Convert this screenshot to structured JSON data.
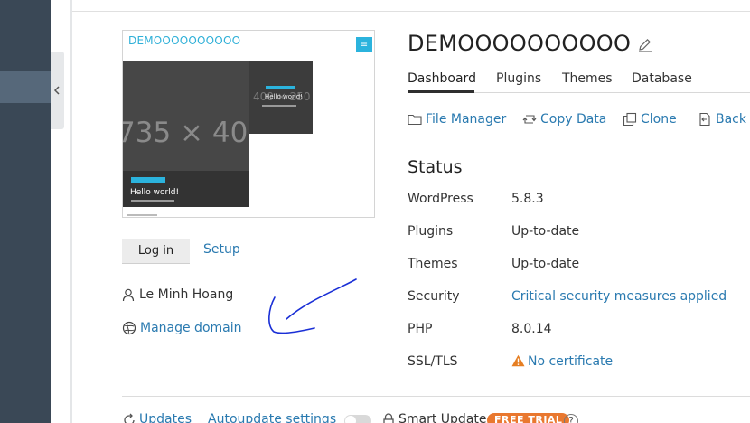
{
  "site": {
    "title": "DEMOOOOOOOOOO"
  },
  "preview": {
    "site_name": "DEMOOOOOOOOOO",
    "menu_glyph": "≡",
    "image_placeholder": "735 × 400",
    "small_placeholder": "400 × 250",
    "post_title_big": "Hello world!",
    "post_title_small": "Hello world!"
  },
  "buttons": {
    "login_label": "Log in",
    "setup_label": "Setup"
  },
  "owner": {
    "name": "Le Minh Hoang"
  },
  "domain": {
    "manage_label": "Manage domain"
  },
  "tabs": [
    {
      "label": "Dashboard",
      "active": true
    },
    {
      "label": "Plugins",
      "active": false
    },
    {
      "label": "Themes",
      "active": false
    },
    {
      "label": "Database",
      "active": false
    }
  ],
  "actions": [
    {
      "label": "File Manager",
      "icon": "folder-icon"
    },
    {
      "label": "Copy Data",
      "icon": "copy-data-icon"
    },
    {
      "label": "Clone",
      "icon": "clone-icon"
    },
    {
      "label": "Back U",
      "icon": "backup-icon"
    }
  ],
  "status": {
    "title": "Status",
    "rows": [
      {
        "key": "WordPress",
        "value": "5.8.3"
      },
      {
        "key": "Plugins",
        "value": "Up-to-date"
      },
      {
        "key": "Themes",
        "value": "Up-to-date"
      },
      {
        "key": "Security",
        "value": "Critical security measures applied"
      },
      {
        "key": "PHP",
        "value": "8.0.14"
      },
      {
        "key": "SSL/TLS",
        "value": "No certificate"
      }
    ]
  },
  "bottom": {
    "updates_label": "Updates",
    "autoupdate_label": "Autoupdate settings",
    "smart_update_label": "Smart Update",
    "trial_badge": "FREE TRIAL",
    "help_glyph": "?"
  },
  "colors": {
    "link": "#2a7ab0",
    "sidebar": "#3a4856",
    "warning": "#e67e22",
    "trial": "#e9782f",
    "annotation": "#1a2fd6"
  }
}
